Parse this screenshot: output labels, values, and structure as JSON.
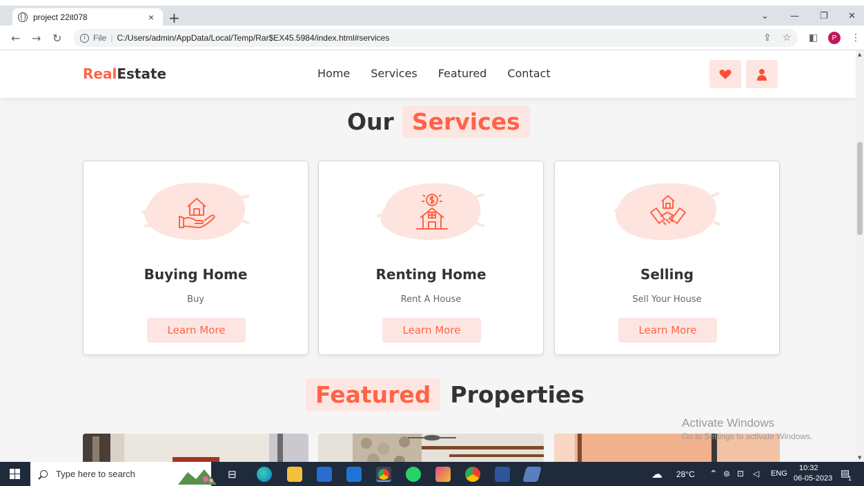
{
  "browser": {
    "tab_title": "project 22it078",
    "tab_close": "×",
    "new_tab": "+",
    "url_scheme": "File",
    "url": "C:/Users/admin/AppData/Local/Temp/Rar$EX45.5984/index.html#services",
    "profile_initial": "P"
  },
  "site": {
    "logo_accent": "Real",
    "logo_rest": "Estate",
    "nav": [
      "Home",
      "Services",
      "Featured",
      "Contact"
    ],
    "accent_color": "#ff6347",
    "accent_bg": "#fde6e2"
  },
  "services": {
    "title_plain": "Our",
    "title_highlight": "Services",
    "cards": [
      {
        "title": "Buying Home",
        "subtitle": "Buy",
        "button": "Learn More",
        "icon": "house-in-hand-icon"
      },
      {
        "title": "Renting Home",
        "subtitle": "Rent A House",
        "button": "Learn More",
        "icon": "house-with-dollar-icon"
      },
      {
        "title": "Selling",
        "subtitle": "Sell Your House",
        "button": "Learn More",
        "icon": "handshake-house-icon"
      }
    ]
  },
  "featured": {
    "title_highlight": "Featured",
    "title_plain": "Properties"
  },
  "watermark": {
    "line1": "Activate Windows",
    "line2": "Go to Settings to activate Windows."
  },
  "taskbar": {
    "search_placeholder": "Type here to search",
    "temperature": "28°C",
    "language": "ENG",
    "time": "10:32",
    "date": "06-05-2023",
    "notifications": "1"
  }
}
